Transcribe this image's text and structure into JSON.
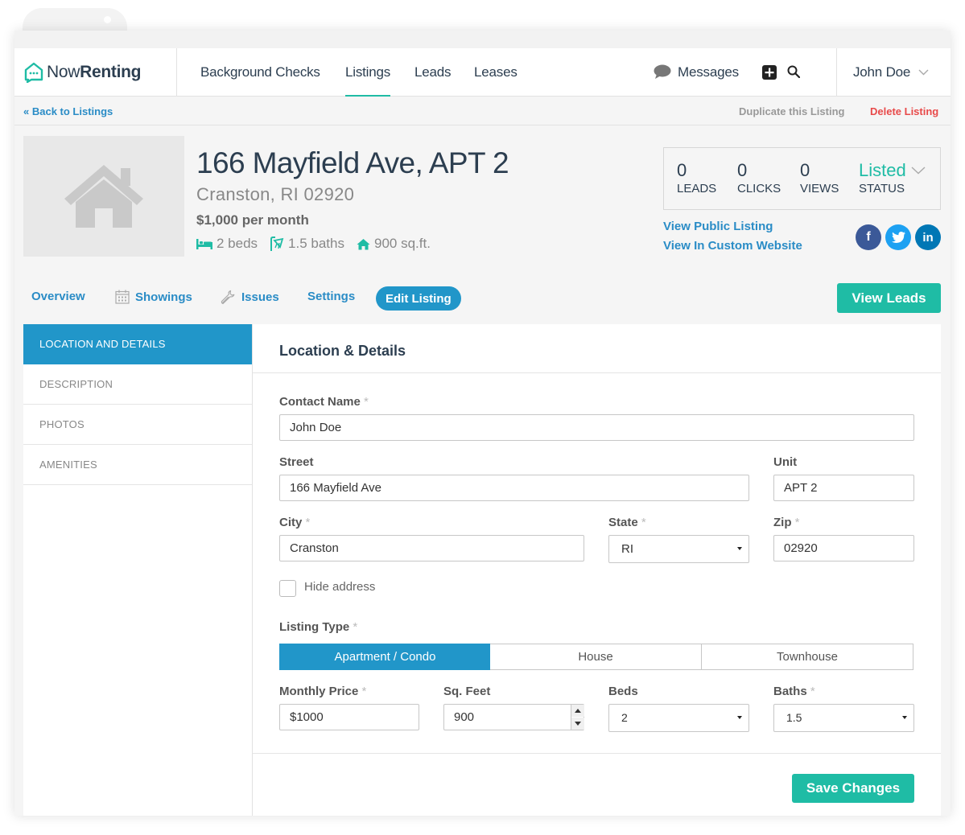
{
  "nav": {
    "logo_now": "Now",
    "logo_renting": "Renting",
    "items": [
      "Background Checks",
      "Listings",
      "Leads",
      "Leases"
    ],
    "active_item": "Listings",
    "messages": "Messages",
    "user": "John Doe"
  },
  "subbar": {
    "back": "« Back to Listings",
    "duplicate": "Duplicate this Listing",
    "delete": "Delete Listing"
  },
  "listing": {
    "address": "166 Mayfield Ave, APT 2",
    "city_line": "Cranston, RI 02920",
    "price": "$1,000 per month",
    "beds": "2 beds",
    "baths": "1.5 baths",
    "sqft": "900 sq.ft."
  },
  "stats": {
    "leads_count": "0",
    "leads_label": "LEADS",
    "clicks_count": "0",
    "clicks_label": "CLICKS",
    "views_count": "0",
    "views_label": "VIEWS",
    "status_value": "Listed",
    "status_label": "STATUS"
  },
  "links": {
    "public": "View Public Listing",
    "custom": "View In Custom Website"
  },
  "social": {
    "facebook": "f",
    "linkedin": "in"
  },
  "tabs": {
    "overview": "Overview",
    "showings": "Showings",
    "issues": "Issues",
    "settings": "Settings",
    "edit": "Edit Listing",
    "view_leads": "View Leads"
  },
  "sidebar": [
    "LOCATION AND DETAILS",
    "DESCRIPTION",
    "PHOTOS",
    "AMENITIES"
  ],
  "form": {
    "heading": "Location & Details",
    "contact_label": "Contact Name",
    "contact_value": "John Doe",
    "street_label": "Street",
    "street_value": "166 Mayfield Ave",
    "unit_label": "Unit",
    "unit_value": "APT 2",
    "city_label": "City",
    "city_value": "Cranston",
    "state_label": "State",
    "state_value": "RI",
    "zip_label": "Zip",
    "zip_value": "02920",
    "hide_address": "Hide address",
    "type_label": "Listing Type",
    "types": [
      "Apartment / Condo",
      "House",
      "Townhouse"
    ],
    "price_label": "Monthly Price",
    "price_value": "$1000",
    "sqft_label": "Sq. Feet",
    "sqft_value": "900",
    "beds_label": "Beds",
    "beds_value": "2",
    "baths_label": "Baths",
    "baths_value": "1.5",
    "required_mark": "*",
    "save": "Save Changes"
  },
  "colors": {
    "accent": "#1fbca5",
    "blue": "#2196c9",
    "link": "#2a8cc6",
    "danger": "#e84a4a"
  }
}
